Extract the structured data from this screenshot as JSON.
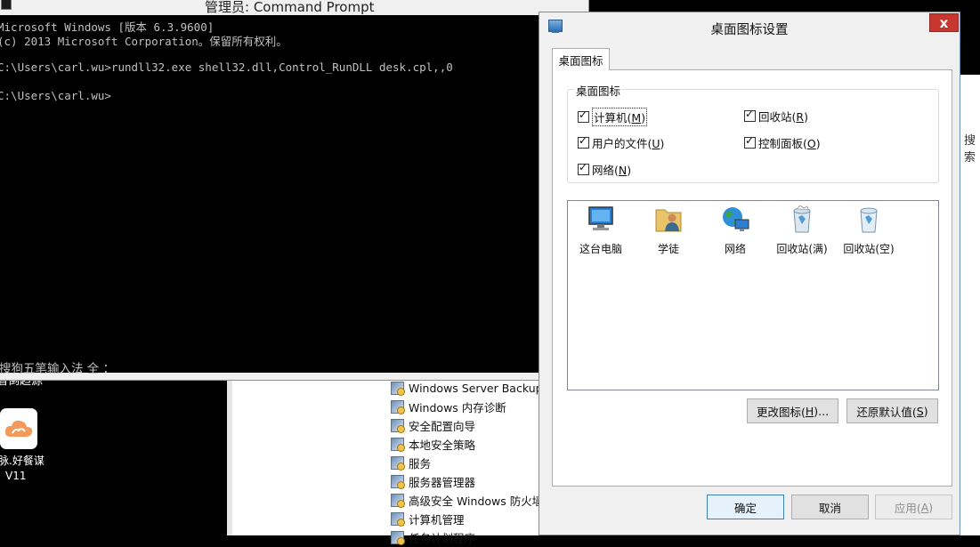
{
  "cmd": {
    "title": "管理员: Command Prompt",
    "lines": [
      "Microsoft Windows [版本 6.3.9600]",
      "(c) 2013 Microsoft Corporation。保留所有权利。",
      "",
      "C:\\Users\\carl.wu>rundll32.exe shell32.dll,Control_RunDLL desk.cpl,,0",
      "",
      "C:\\Users\\carl.wu>"
    ],
    "ime_status": "搜狗五笔输入法 全 ："
  },
  "desktop": {
    "top_label": "看倒趋源",
    "app_caption_line1": "脉.好餐谋",
    "app_caption_line2": "V11"
  },
  "explorer": {
    "items": [
      "Windows Server Backup",
      "Windows 内存诊断",
      "安全配置向导",
      "本地安全策略",
      "服务",
      "服务器管理器",
      "高级安全 Windows 防火墙",
      "计算机管理",
      "任务计划程序"
    ]
  },
  "right_window": {
    "hint": "搜索"
  },
  "dialog": {
    "title": "桌面图标设置",
    "close": "x",
    "tab": "桌面图标",
    "group_label": "桌面图标",
    "checkboxes": {
      "computer": {
        "label": "计算机(",
        "key": "M",
        "end": ")",
        "checked": true
      },
      "recycle": {
        "label": "回收站(",
        "key": "R",
        "end": ")",
        "checked": true
      },
      "userfiles": {
        "label": "用户的文件(",
        "key": "U",
        "end": ")",
        "checked": true
      },
      "control": {
        "label": "控制面板(",
        "key": "O",
        "end": ")",
        "checked": true
      },
      "network": {
        "label": "网络(",
        "key": "N",
        "end": ")",
        "checked": true
      }
    },
    "icons": {
      "pc": "这台电脑",
      "user": "学徒",
      "network": "网络",
      "recycle_full": "回收站(满)",
      "recycle_empty": "回收站(空)"
    },
    "change_icon": {
      "label": "更改图标(",
      "key": "H",
      "end": ")..."
    },
    "restore_default": {
      "label": "还原默认值(",
      "key": "S",
      "end": ")"
    },
    "ok": "确定",
    "cancel": "取消",
    "apply": {
      "label": "应用(",
      "key": "A",
      "end": ")"
    }
  }
}
